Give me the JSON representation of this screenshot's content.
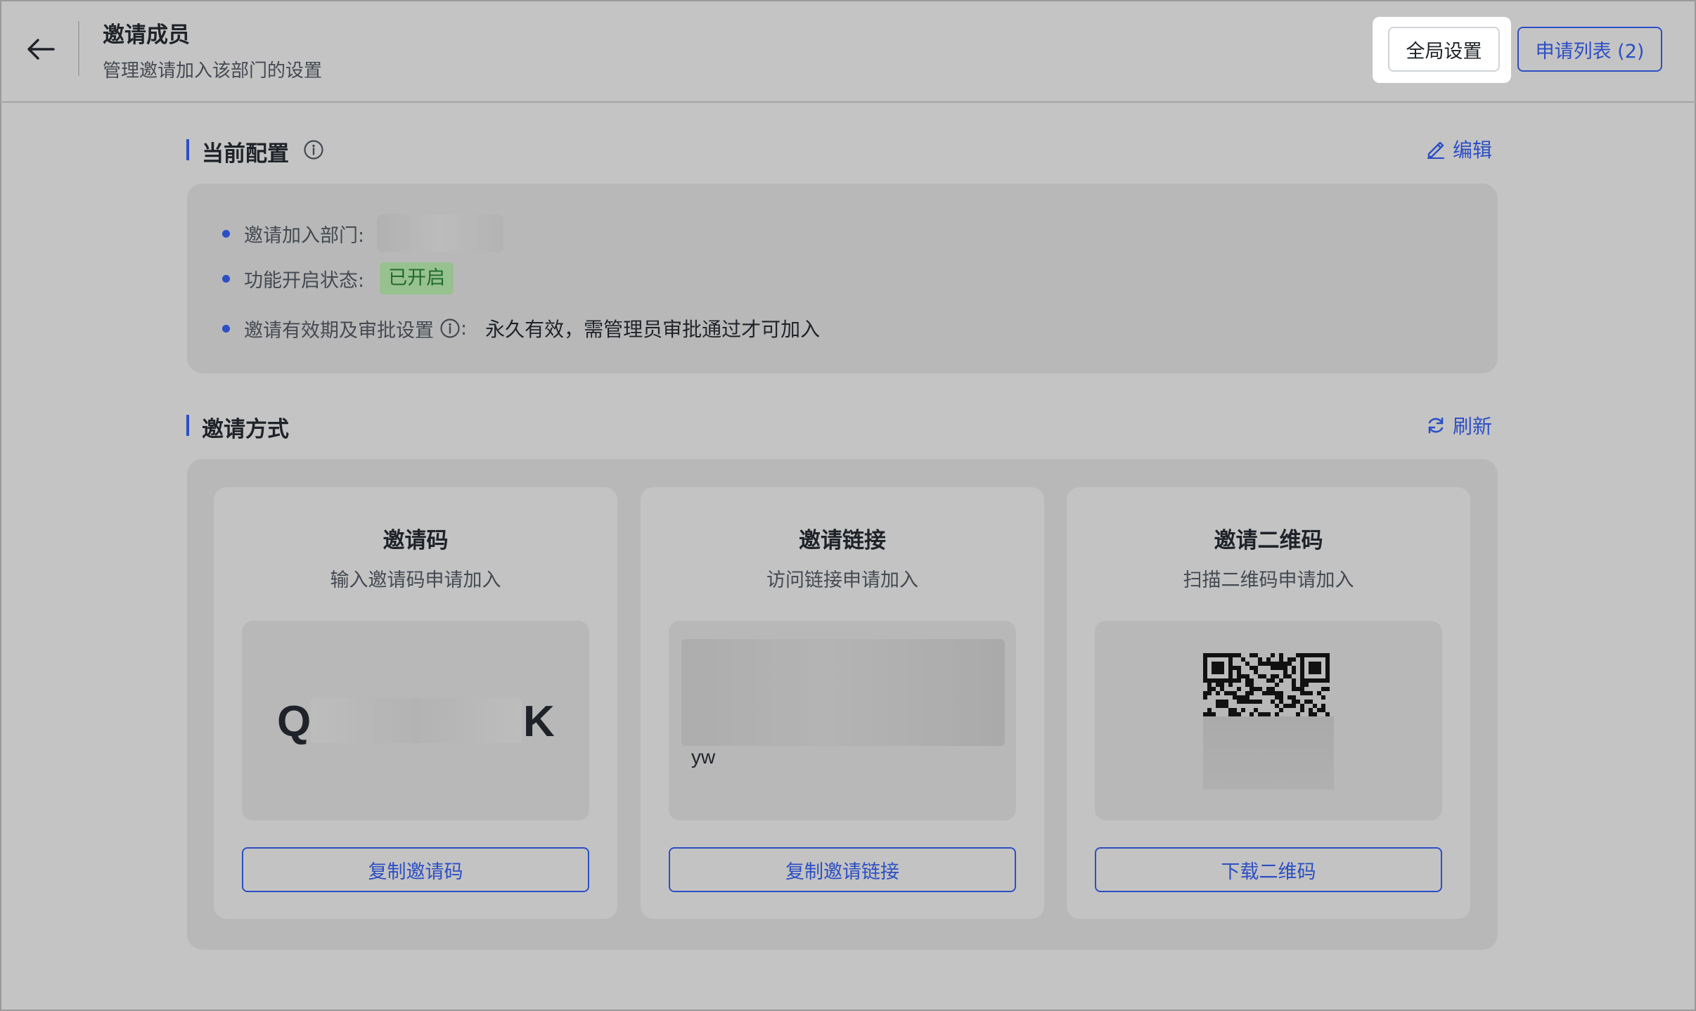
{
  "header": {
    "title": "邀请成员",
    "subtitle": "管理邀请加入该部门的设置",
    "global_settings_label": "全局设置",
    "apply_list_label": "申请列表 (2)"
  },
  "config": {
    "title": "当前配置",
    "edit_label": "编辑",
    "rows": [
      {
        "label": "邀请加入部门:",
        "value": ""
      },
      {
        "label": "功能开启状态:",
        "value": "已开启"
      },
      {
        "label": "邀请有效期及审批设置",
        "suffix": ":",
        "value": "永久有效，需管理员审批通过才可加入"
      }
    ]
  },
  "invite": {
    "title": "邀请方式",
    "refresh_label": "刷新",
    "cards": [
      {
        "title": "邀请码",
        "desc": "输入邀请码申请加入",
        "code_first": "Q",
        "code_last": "K",
        "button": "复制邀请码"
      },
      {
        "title": "邀请链接",
        "desc": "访问链接申请加入",
        "link_tail": "yw",
        "button": "复制邀请链接"
      },
      {
        "title": "邀请二维码",
        "desc": "扫描二维码申请加入",
        "button": "下载二维码"
      }
    ]
  },
  "colors": {
    "accent": "#2c4fc4",
    "background": "#c4c4c4",
    "panel": "#b8b8b8",
    "status_bg": "#98c190",
    "status_text": "#1e6b2b"
  },
  "icons": {
    "back": "arrow-left-icon",
    "info": "info-circle-icon",
    "edit": "pencil-icon",
    "refresh": "refresh-icon",
    "qr": "qr-code-icon"
  }
}
